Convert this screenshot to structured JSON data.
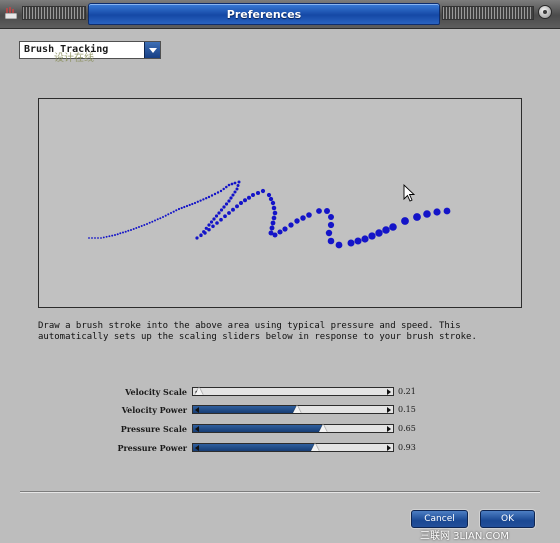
{
  "window": {
    "title": "Preferences",
    "accent_color": "#1a4aa5"
  },
  "mode_dropdown": {
    "selected": "Brush Tracking",
    "icon": "chevron-down-icon"
  },
  "watermark_top": "设计在线",
  "drawing_area": {
    "stroke_color": "#1414c8",
    "cursor_icon": "arrow-cursor-icon"
  },
  "instructions": {
    "line1": "Draw a brush stroke into the above area using typical pressure and speed.  This",
    "line2": "automatically sets up the scaling sliders below in response to your brush stroke."
  },
  "sliders": [
    {
      "label": "Velocity Scale",
      "value_text": "0.21",
      "fraction": 0.0
    },
    {
      "label": "Velocity Power",
      "value_text": "0.15",
      "fraction": 0.52
    },
    {
      "label": "Pressure Scale",
      "value_text": "0.65",
      "fraction": 0.65
    },
    {
      "label": "Pressure Power",
      "value_text": "0.93",
      "fraction": 0.61
    }
  ],
  "buttons": {
    "cancel": "Cancel",
    "ok": "OK"
  },
  "watermark_bottom": "三联网 3LIAN.COM"
}
